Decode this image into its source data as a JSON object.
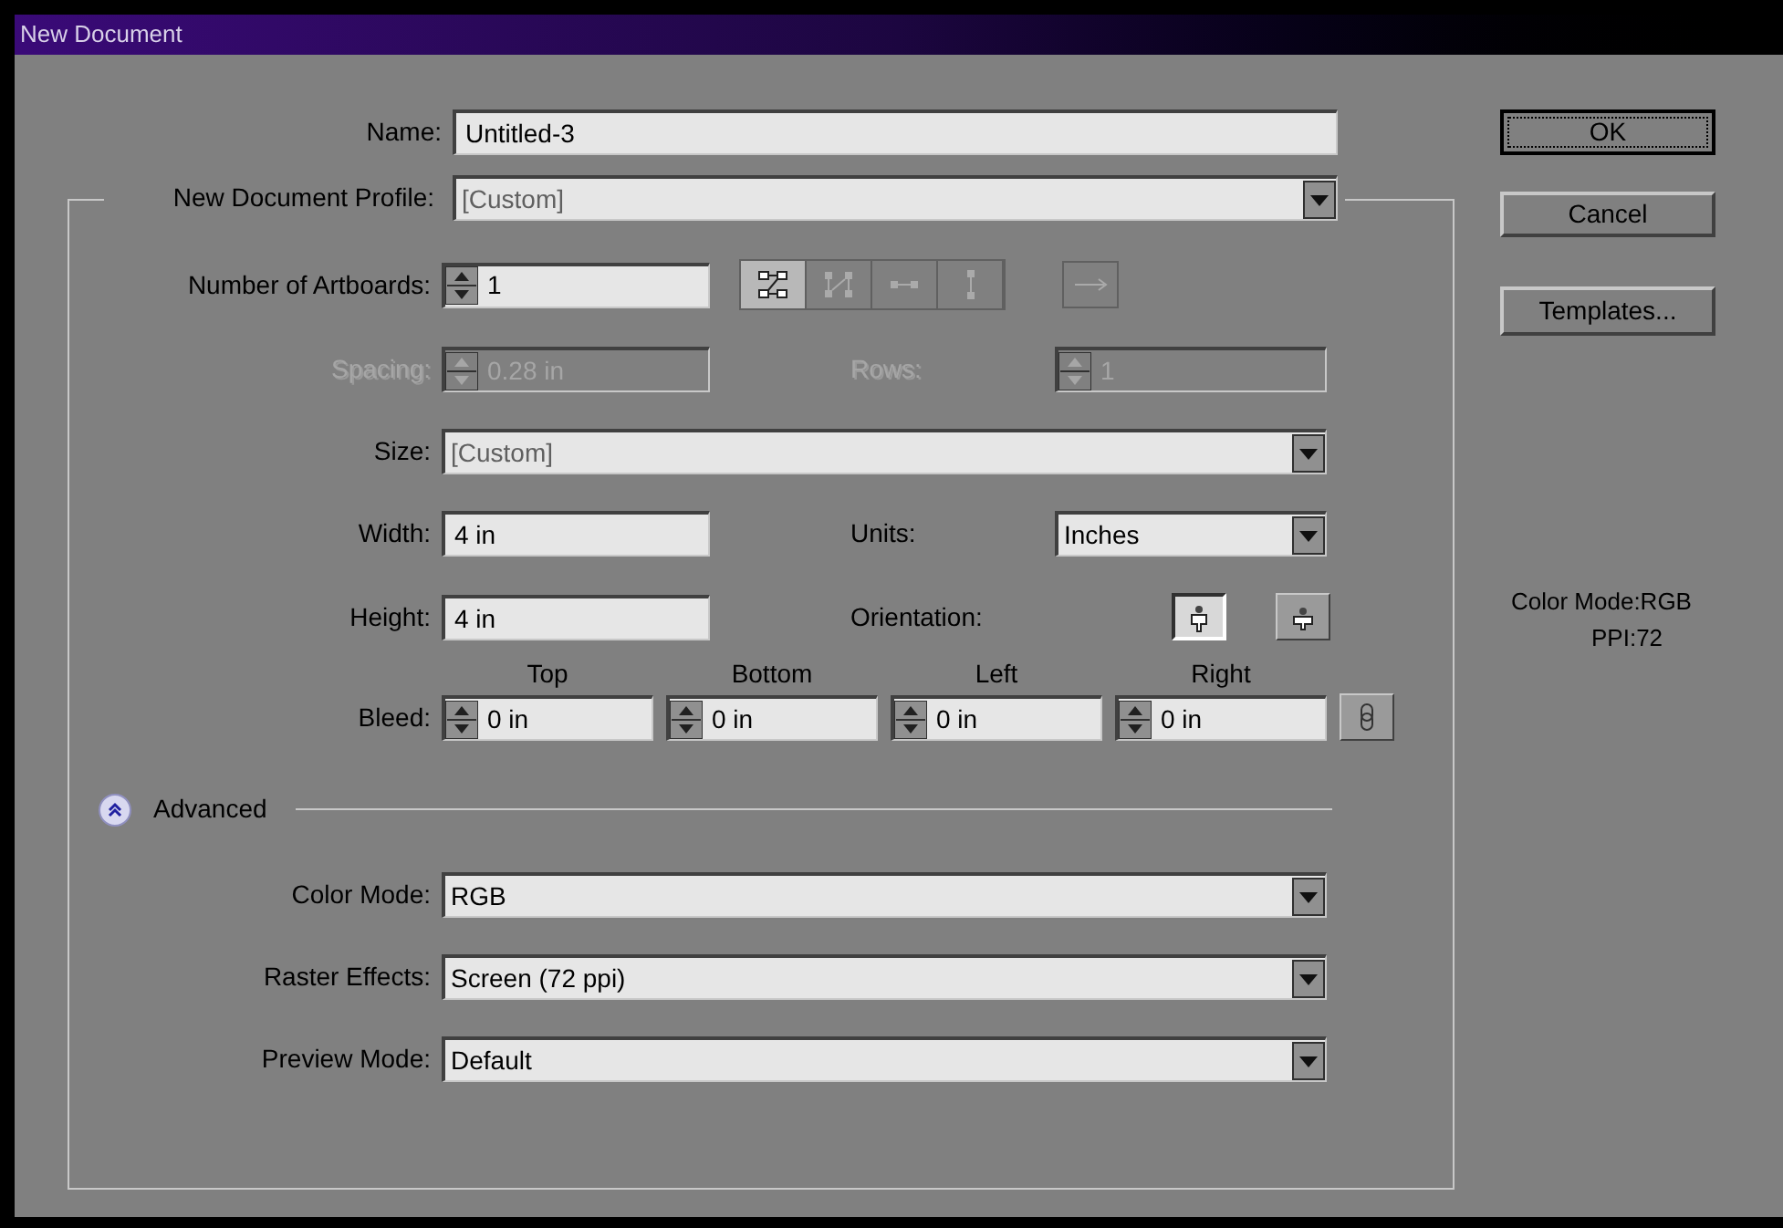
{
  "window": {
    "title": "New Document"
  },
  "name": {
    "label": "Name:",
    "value": "Untitled-3"
  },
  "profile": {
    "label": "New Document Profile:",
    "value": "[Custom]"
  },
  "artboards": {
    "label": "Number of Artboards:",
    "value": "1",
    "disabled": false,
    "layouts": [
      {
        "kind": "grid-by-row",
        "selected": true
      },
      {
        "kind": "grid-by-column",
        "selected": false
      },
      {
        "kind": "row",
        "selected": false
      },
      {
        "kind": "column",
        "selected": false
      }
    ]
  },
  "spacing": {
    "label": "Spacing:",
    "value": "0.28 in",
    "disabled": true
  },
  "rows": {
    "label": "Rows:",
    "value": "1",
    "disabled": true
  },
  "size": {
    "label": "Size:",
    "value": "[Custom]"
  },
  "width": {
    "label": "Width:",
    "value": "4 in"
  },
  "units": {
    "label": "Units:",
    "value": "Inches"
  },
  "height": {
    "label": "Height:",
    "value": "4 in"
  },
  "orientation": {
    "label": "Orientation:",
    "options": [
      {
        "kind": "portrait",
        "selected": true
      },
      {
        "kind": "landscape",
        "selected": false
      }
    ]
  },
  "bleed": {
    "label": "Bleed:",
    "sides": [
      {
        "heading": "Top",
        "value": "0 in"
      },
      {
        "heading": "Bottom",
        "value": "0 in"
      },
      {
        "heading": "Left",
        "value": "0 in"
      },
      {
        "heading": "Right",
        "value": "0 in"
      }
    ]
  },
  "advanced": {
    "label": "Advanced",
    "expanded": true,
    "settings": [
      {
        "label": "Color Mode:",
        "value": "RGB"
      },
      {
        "label": "Raster Effects:",
        "value": "Screen (72 ppi)"
      },
      {
        "label": "Preview Mode:",
        "value": "Default"
      }
    ]
  },
  "buttons": [
    {
      "label": "OK",
      "focused": true
    },
    {
      "label": "Cancel",
      "focused": false
    },
    {
      "label": "Templates...",
      "focused": false
    }
  ],
  "summary": [
    "Color Mode:RGB",
    "PPI:72"
  ]
}
